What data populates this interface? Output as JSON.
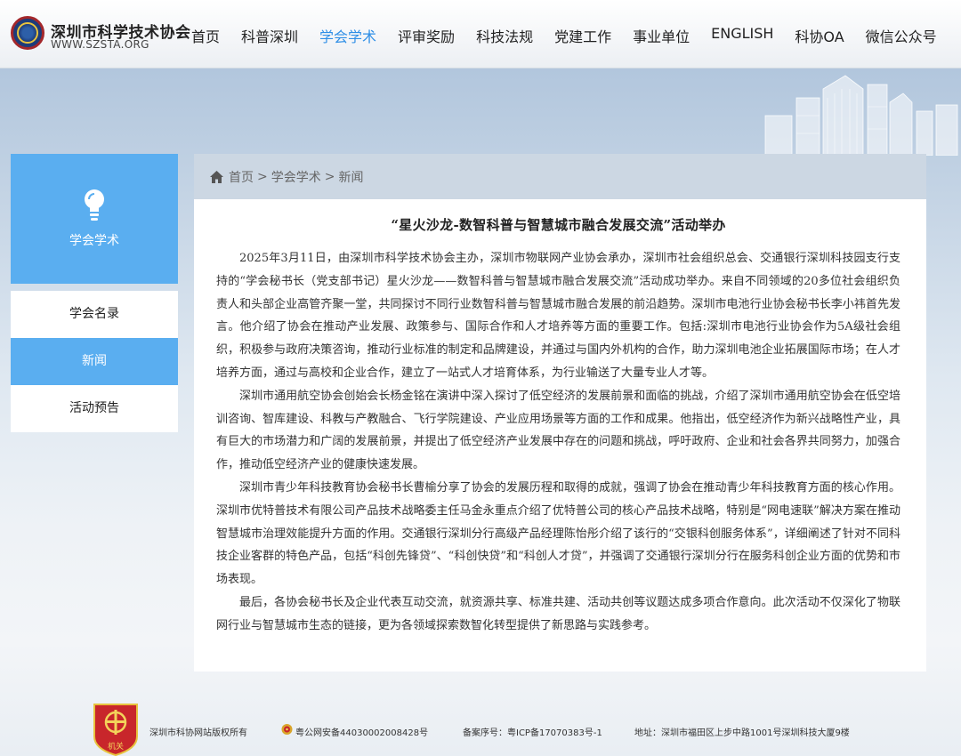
{
  "header": {
    "brand_name": "深圳市科学技术协会",
    "brand_url": "WWW.SZSTA.ORG",
    "nav": [
      {
        "label": "首页",
        "active": false
      },
      {
        "label": "科普深圳",
        "active": false
      },
      {
        "label": "学会学术",
        "active": true
      },
      {
        "label": "评审奖励",
        "active": false
      },
      {
        "label": "科技法规",
        "active": false
      },
      {
        "label": "党建工作",
        "active": false
      },
      {
        "label": "事业单位",
        "active": false
      },
      {
        "label": "ENGLISH",
        "active": false
      },
      {
        "label": "科协OA",
        "active": false
      },
      {
        "label": "微信公众号",
        "active": false
      }
    ],
    "active_color": "#2f8fe6"
  },
  "sidebar": {
    "title": "学会学术",
    "icon": "lightbulb-icon",
    "accent": "#5aaef0",
    "items": [
      {
        "label": "学会名录",
        "active": false
      },
      {
        "label": "新闻",
        "active": true
      },
      {
        "label": "活动预告",
        "active": false
      }
    ]
  },
  "breadcrumb": {
    "icon": "home-icon",
    "items": [
      "首页",
      "学会学术",
      "新闻"
    ],
    "separator": ">"
  },
  "article": {
    "title": "“星火沙龙-数智科普与智慧城市融合发展交流”活动举办",
    "paragraphs": [
      "2025年3月11日，由深圳市科学技术协会主办，深圳市物联网产业协会承办，深圳市社会组织总会、交通银行深圳科技园支行支持的“学会秘书长（党支部书记）星火沙龙——数智科普与智慧城市融合发展交流”活动成功举办。来自不同领域的20多位社会组织负责人和头部企业高管齐聚一堂，共同探讨不同行业数智科普与智慧城市融合发展的前沿趋势。深圳市电池行业协会秘书长李小祎首先发言。他介绍了协会在推动产业发展、政策参与、国际合作和人才培养等方面的重要工作。包括:深圳市电池行业协会作为5A级社会组织，积极参与政府决策咨询，推动行业标准的制定和品牌建设，并通过与国内外机构的合作，助力深圳电池企业拓展国际市场；在人才培养方面，通过与高校和企业合作，建立了一站式人才培育体系，为行业输送了大量专业人才等。",
      "深圳市通用航空协会创始会长杨金铭在演讲中深入探讨了低空经济的发展前景和面临的挑战，介绍了深圳市通用航空协会在低空培训咨询、智库建设、科教与产教融合、飞行学院建设、产业应用场景等方面的工作和成果。他指出，低空经济作为新兴战略性产业，具有巨大的市场潜力和广阔的发展前景，并提出了低空经济产业发展中存在的问题和挑战，呼吁政府、企业和社会各界共同努力，加强合作，推动低空经济产业的健康快速发展。",
      "深圳市青少年科技教育协会秘书长曹榆分享了协会的发展历程和取得的成就，强调了协会在推动青少年科技教育方面的核心作用。深圳市优特普技术有限公司产品技术战略委主任马金永重点介绍了优特普公司的核心产品技术战略，特别是“网电速联”解决方案在推动智慧城市治理效能提升方面的作用。交通银行深圳分行高级产品经理陈怡彤介绍了该行的“交银科创服务体系”，详细阐述了针对不同科技企业客群的特色产品，包括“科创先锋贷”、“科创快贷”和“科创人才贷”，并强调了交通银行深圳分行在服务科创企业方面的优势和市场表现。",
      "最后，各协会秘书长及企业代表互动交流，就资源共享、标准共建、活动共创等议题达成多项合作意向。此次活动不仅深化了物联网行业与智慧城市生态的链接，更为各领域探索数智化转型提供了新思路与实践参考。"
    ]
  },
  "footer": {
    "badge_text": "机关",
    "copyright": "深圳市科协网站版权所有",
    "police_icon": "police-badge-icon",
    "police_record": "粤公网安备44030002008428号",
    "icp": "备案序号：粤ICP备17070383号-1",
    "address": "地址：深圳市福田区上步中路1001号深圳科技大厦9楼"
  }
}
